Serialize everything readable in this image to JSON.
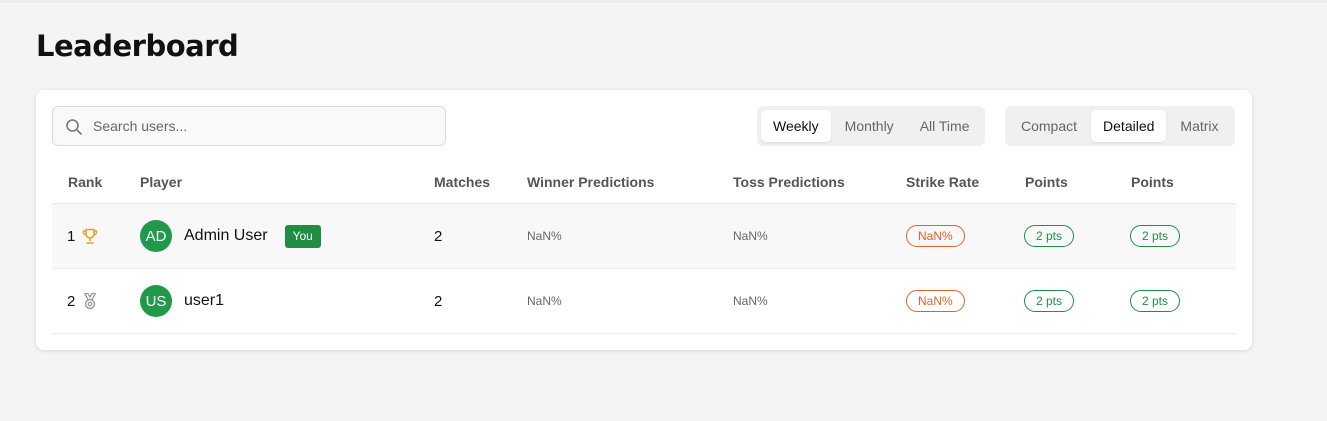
{
  "page": {
    "title": "Leaderboard"
  },
  "search": {
    "placeholder": "Search users..."
  },
  "period_tabs": [
    "Weekly",
    "Monthly",
    "All Time"
  ],
  "period_selected": "Weekly",
  "view_tabs": [
    "Compact",
    "Detailed",
    "Matrix"
  ],
  "view_selected": "Detailed",
  "columns": {
    "rank": "Rank",
    "player": "Player",
    "matches": "Matches",
    "winner": "Winner Predictions",
    "toss": "Toss Predictions",
    "strike": "Strike Rate",
    "points_a": "Points",
    "points_b": "Points"
  },
  "rows": [
    {
      "rank": "1",
      "rank_icon": "trophy-icon",
      "initials": "AD",
      "name": "Admin User",
      "badge": "You",
      "matches": "2",
      "winner": "NaN%",
      "toss": "NaN%",
      "strike": "NaN%",
      "points_a": "2 pts",
      "points_b": "2 pts"
    },
    {
      "rank": "2",
      "rank_icon": "medal-icon",
      "initials": "US",
      "name": "user1",
      "matches": "2",
      "winner": "NaN%",
      "toss": "NaN%",
      "strike": "NaN%",
      "points_a": "2 pts",
      "points_b": "2 pts"
    }
  ],
  "colors": {
    "accent_green": "#1f9a4a",
    "strike_orange": "#e0632a",
    "trophy_gold": "#e8a317",
    "medal_gray": "#9a9a9a"
  }
}
